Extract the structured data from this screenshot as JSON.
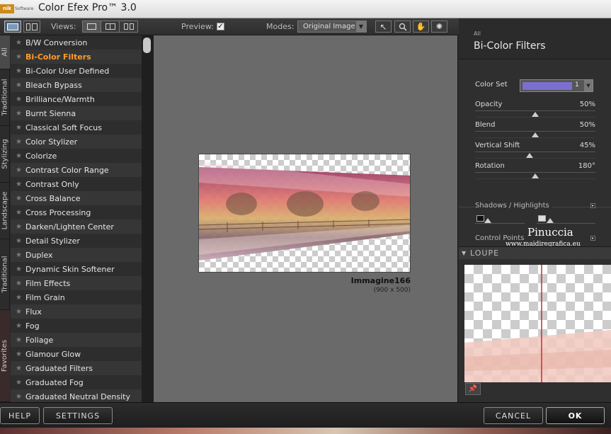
{
  "app": {
    "logo_text": "nik",
    "logo_sub": "Software",
    "title": "Color Efex Pro™ 3.0"
  },
  "toolbar": {
    "views_label": "Views:",
    "preview_label": "Preview:",
    "preview_checked": "✓",
    "modes_label": "Modes:",
    "mode_value": "Original Image"
  },
  "vtabs": [
    "All",
    "Traditional",
    "Stylizing",
    "Landscape",
    "Traditional",
    "Favorites"
  ],
  "filters": {
    "items": [
      "B/W Conversion",
      "Bi-Color Filters",
      "Bi-Color User Defined",
      "Bleach Bypass",
      "Brilliance/Warmth",
      "Burnt Sienna",
      "Classical Soft Focus",
      "Color Stylizer",
      "Colorize",
      "Contrast Color Range",
      "Contrast Only",
      "Cross Balance",
      "Cross Processing",
      "Darken/Lighten Center",
      "Detail Stylizer",
      "Duplex",
      "Dynamic Skin Softener",
      "Film Effects",
      "Film Grain",
      "Flux",
      "Fog",
      "Foliage",
      "Glamour Glow",
      "Graduated Filters",
      "Graduated Fog",
      "Graduated Neutral Density"
    ],
    "selected": "Bi-Color Filters"
  },
  "preview": {
    "image_name": "Immagine166",
    "image_size": "(900 x 500)"
  },
  "panel": {
    "category": "All",
    "title": "Bi-Color Filters",
    "color_set_label": "Color Set",
    "color_set_value": "1",
    "color_set_color": "#7a70d0",
    "controls": [
      {
        "label": "Opacity",
        "value": "50%",
        "level": 0.5
      },
      {
        "label": "Blend",
        "value": "50%",
        "level": 0.5
      },
      {
        "label": "Vertical Shift",
        "value": "45%",
        "level": 0.45
      },
      {
        "label": "Rotation",
        "value": "180°",
        "level": 0.5
      }
    ],
    "shadows_label": "Shadows / Highlights",
    "control_points_label": "Control Points",
    "loupe_label": "LOUPE"
  },
  "watermark": {
    "name": "Pinuccia",
    "url": "www.maidiregrafica.eu"
  },
  "bottom": {
    "help": "HELP",
    "settings": "SETTINGS",
    "cancel": "CANCEL",
    "ok": "OK"
  }
}
